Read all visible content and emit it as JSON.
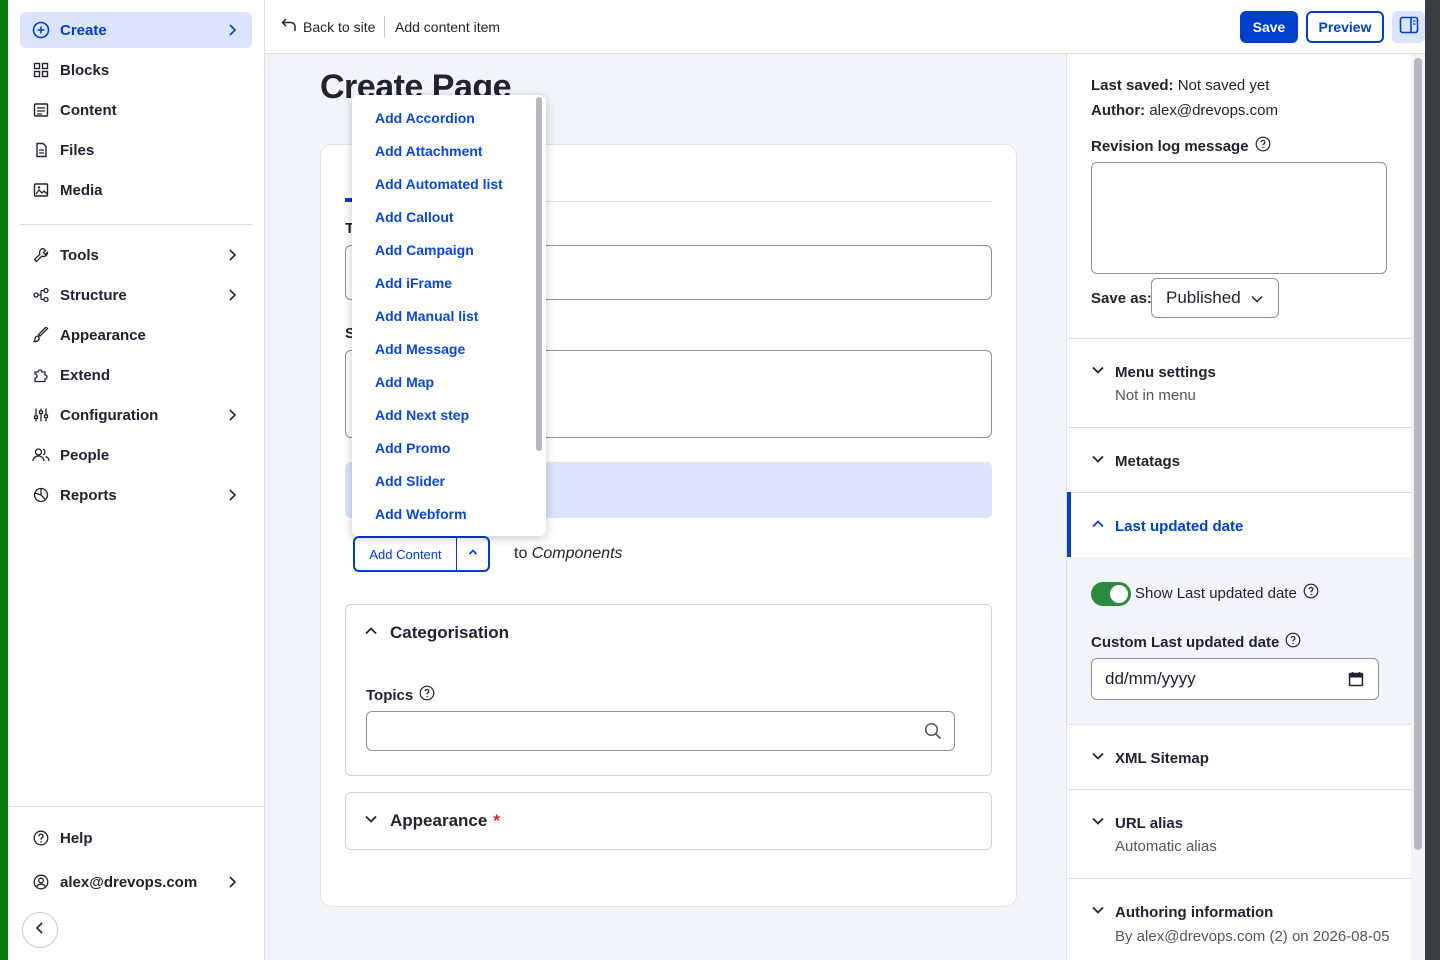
{
  "sidebar": {
    "create": "Create",
    "blocks": "Blocks",
    "content": "Content",
    "files": "Files",
    "media": "Media",
    "tools": "Tools",
    "structure": "Structure",
    "appearance": "Appearance",
    "extend": "Extend",
    "configuration": "Configuration",
    "people": "People",
    "reports": "Reports",
    "help": "Help",
    "user": "alex@drevops.com"
  },
  "topbar": {
    "back": "Back to site",
    "title": "Add content item",
    "save": "Save",
    "preview": "Preview"
  },
  "main": {
    "page_title": "Create Page",
    "title_label_stub": "T",
    "summary_label_stub": "S",
    "add_content_button": "Add Content",
    "to_prefix": "to",
    "to_target": "Components",
    "categorisation": "Categorisation",
    "topics_label": "Topics",
    "appearance": "Appearance",
    "required_mark": "*"
  },
  "dropdown": {
    "items": [
      "Add Accordion",
      "Add Attachment",
      "Add Automated list",
      "Add Callout",
      "Add Campaign",
      "Add iFrame",
      "Add Manual list",
      "Add Message",
      "Add Map",
      "Add Next step",
      "Add Promo",
      "Add Slider",
      "Add Webform"
    ]
  },
  "meta": {
    "last_saved_label": "Last saved:",
    "last_saved_value": "Not saved yet",
    "author_label": "Author:",
    "author_value": "alex@drevops.com",
    "revision_label": "Revision log message",
    "save_as_label": "Save as:",
    "save_as_value": "Published",
    "menu_settings": "Menu settings",
    "menu_settings_sub": "Not in menu",
    "metatags": "Metatags",
    "last_updated": "Last updated date",
    "show_last_updated": "Show Last updated date",
    "show_last_updated_on": true,
    "custom_last_updated": "Custom Last updated date",
    "date_placeholder": "dd/mm/yyyy",
    "xml_sitemap": "XML Sitemap",
    "url_alias": "URL alias",
    "url_alias_sub": "Automatic alias",
    "authoring": "Authoring information",
    "authoring_sub": "By alex@drevops.com (2) on 2026-08-05"
  },
  "colors": {
    "accent": "#003ecc",
    "accent_light": "#dbe4fb",
    "toggle_on": "#2c8a3f",
    "required": "#d72222"
  }
}
